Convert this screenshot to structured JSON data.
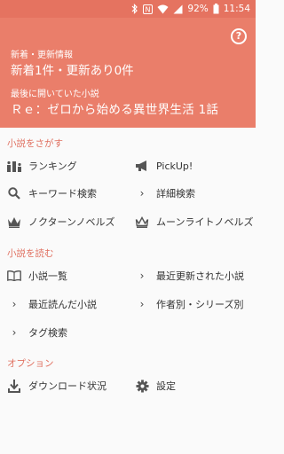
{
  "status_bar": {
    "icons": [
      "bluetooth-icon",
      "nfc-icon",
      "wifi-icon",
      "signal-icon",
      "battery-icon"
    ],
    "battery": "92%",
    "time": "11:54"
  },
  "header": {
    "bg_color": "#ea7e6a",
    "updates_label": "新着・更新情報",
    "updates_value": "新着1件・更新あり0件",
    "last_opened_label": "最後に開いていた小説",
    "last_opened_value": "Ｒｅ：ゼロから始める異世界生活 1話",
    "help_label": "?"
  },
  "sections": {
    "find": {
      "title": "小説をさがす",
      "ranking": "ランキング",
      "pickup": "PickUp!",
      "keyword": "キーワード検索",
      "detail": "詳細検索",
      "nocturne": "ノクターンノベルズ",
      "moonlight": "ムーンライトノベルズ"
    },
    "read": {
      "title": "小説を読む",
      "list": "小説一覧",
      "recent_updated": "最近更新された小説",
      "recent_read": "最近読んだ小説",
      "by_author": "作者別・シリーズ別",
      "tag_search": "タグ検索"
    },
    "options": {
      "title": "オプション",
      "download": "ダウンロード状況",
      "settings": "設定"
    }
  },
  "accent_color": "#e07060"
}
